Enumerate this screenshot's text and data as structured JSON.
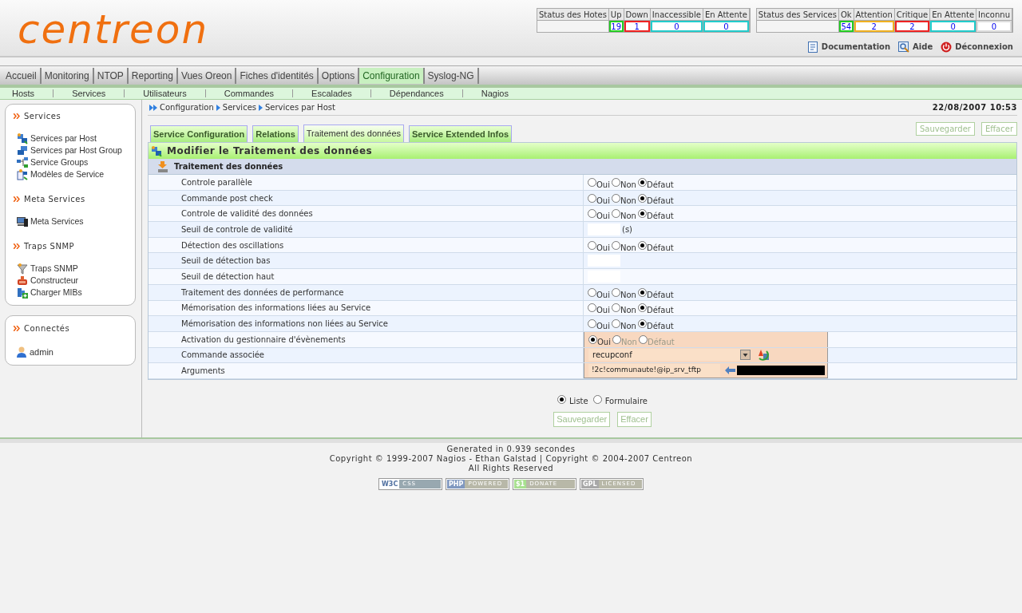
{
  "logo": {
    "text": "centreon"
  },
  "host_status": {
    "header": "Status des Hotes",
    "columns": [
      {
        "label": "Up",
        "value": "19",
        "color": "#22cc22"
      },
      {
        "label": "Down",
        "value": "1",
        "color": "#ee2222"
      },
      {
        "label": "Inaccessible",
        "value": "0",
        "color": "#22cccc"
      },
      {
        "label": "En Attente",
        "value": "0",
        "color": "#22cccc"
      }
    ]
  },
  "service_status": {
    "header": "Status des Services",
    "columns": [
      {
        "label": "Ok",
        "value": "54",
        "color": "#22cc22"
      },
      {
        "label": "Attention",
        "value": "2",
        "color": "#f0b020"
      },
      {
        "label": "Critique",
        "value": "2",
        "color": "#ee2222"
      },
      {
        "label": "En Attente",
        "value": "0",
        "color": "#22cccc"
      },
      {
        "label": "Inconnu",
        "value": "0",
        "color": "#dddddd"
      }
    ]
  },
  "top_links": [
    {
      "label": "Documentation",
      "kind": "doc"
    },
    {
      "label": "Aide",
      "kind": "help"
    },
    {
      "label": "Déconnexion",
      "kind": "logout"
    }
  ],
  "menu": [
    {
      "label": "Accueil",
      "selected": false
    },
    {
      "label": "Monitoring",
      "selected": false
    },
    {
      "label": "NTOP",
      "selected": false
    },
    {
      "label": "Reporting",
      "selected": false
    },
    {
      "label": "Vues Oreon",
      "selected": false
    },
    {
      "label": "Fiches d'identités",
      "selected": false
    },
    {
      "label": "Options",
      "selected": false
    },
    {
      "label": "Configuration",
      "selected": true
    },
    {
      "label": "Syslog-NG",
      "selected": false
    }
  ],
  "submenu": [
    "Hosts",
    "Services",
    "Utilisateurs",
    "Commandes",
    "Escalades",
    "Dépendances",
    "Nagios"
  ],
  "sidebar": {
    "sections": [
      {
        "title": "Services",
        "items": [
          {
            "label": "Services par Host",
            "kind": "host"
          },
          {
            "label": "Services par Host Group",
            "kind": "hostgroup"
          },
          {
            "label": "Service Groups",
            "kind": "group"
          },
          {
            "label": "Modèles de Service",
            "kind": "template"
          }
        ]
      },
      {
        "title": "Meta Services",
        "items": [
          {
            "label": "Meta Services",
            "kind": "computer"
          }
        ]
      },
      {
        "title": "Traps SNMP",
        "items": [
          {
            "label": "Traps SNMP",
            "kind": "funnel"
          },
          {
            "label": "Constructeur",
            "kind": "box"
          },
          {
            "label": "Charger MIBs",
            "kind": "add"
          }
        ]
      }
    ]
  },
  "connected": {
    "title": "Connectés",
    "users": [
      "admin"
    ]
  },
  "breadcrumb": [
    "Configuration",
    "Services",
    "Services par Host"
  ],
  "datetime": "22/08/2007 10:53",
  "tabs": [
    {
      "label": "Service Configuration",
      "selected": false
    },
    {
      "label": "Relations",
      "selected": false
    },
    {
      "label": "Traitement des données",
      "selected": true
    },
    {
      "label": "Service Extended Infos",
      "selected": false
    }
  ],
  "top_buttons": [
    "Sauvegarder",
    "Effacer"
  ],
  "form_title": "Modifier le Traitement des données",
  "section_title": "Traitement des données",
  "rows": [
    {
      "label": "Controle parallèle",
      "kind": "radio",
      "highlighted": false,
      "options": [
        {
          "label": "Oui",
          "selected": false
        },
        {
          "label": "Non",
          "selected": false
        },
        {
          "label": "Défaut",
          "selected": true
        }
      ]
    },
    {
      "label": "Commande post check",
      "kind": "radio",
      "highlighted": false,
      "options": [
        {
          "label": "Oui",
          "selected": false
        },
        {
          "label": "Non",
          "selected": false
        },
        {
          "label": "Défaut",
          "selected": true
        }
      ]
    },
    {
      "label": "Controle de validité des données",
      "kind": "radio",
      "highlighted": false,
      "options": [
        {
          "label": "Oui",
          "selected": false
        },
        {
          "label": "Non",
          "selected": false
        },
        {
          "label": "Défaut",
          "selected": true
        }
      ]
    },
    {
      "label": "Seuil de controle de validité",
      "kind": "input",
      "highlighted": false,
      "unit": "(s)"
    },
    {
      "label": "Détection des oscillations",
      "kind": "radio",
      "highlighted": false,
      "options": [
        {
          "label": "Oui",
          "selected": false
        },
        {
          "label": "Non",
          "selected": false
        },
        {
          "label": "Défaut",
          "selected": true
        }
      ]
    },
    {
      "label": "Seuil de détection bas",
      "kind": "input",
      "highlighted": false
    },
    {
      "label": "Seuil de détection haut",
      "kind": "input",
      "highlighted": false
    },
    {
      "label": "Traitement des données de performance",
      "kind": "radio",
      "highlighted": false,
      "options": [
        {
          "label": "Oui",
          "selected": false
        },
        {
          "label": "Non",
          "selected": false
        },
        {
          "label": "Défaut",
          "selected": true
        }
      ]
    },
    {
      "label": "Mémorisation des informations liées au Service",
      "kind": "radio",
      "highlighted": false,
      "options": [
        {
          "label": "Oui",
          "selected": false
        },
        {
          "label": "Non",
          "selected": false
        },
        {
          "label": "Défaut",
          "selected": true
        }
      ]
    },
    {
      "label": "Mémorisation des informations non liées au Service",
      "kind": "radio",
      "highlighted": false,
      "options": [
        {
          "label": "Oui",
          "selected": false
        },
        {
          "label": "Non",
          "selected": false
        },
        {
          "label": "Défaut",
          "selected": true
        }
      ]
    },
    {
      "label": "Activation du gestionnaire d'évènements",
      "kind": "radio",
      "highlighted": true,
      "options": [
        {
          "label": "Oui",
          "selected": true
        },
        {
          "label": "Non",
          "selected": false
        },
        {
          "label": "Défaut",
          "selected": false
        }
      ]
    },
    {
      "label": "Commande associée",
      "kind": "select",
      "highlighted": true,
      "value": "recupconf"
    },
    {
      "label": "Arguments",
      "kind": "args",
      "highlighted": true,
      "value": "!2c!communaute!@ip_srv_tftp"
    }
  ],
  "view_mode": [
    {
      "label": "Liste",
      "selected": true
    },
    {
      "label": "Formulaire",
      "selected": false
    }
  ],
  "bottom_buttons": [
    "Sauvegarder",
    "Effacer"
  ],
  "footer": {
    "lines": [
      "Generated in 0.939 secondes",
      "Copyright © 1999-2007 Nagios - Ethan Galstad | Copyright © 2004-2007 Centreon",
      "All Rights Reserved"
    ],
    "badges": [
      {
        "left": "W3C",
        "right": "CSS",
        "kind": "w3c"
      },
      {
        "left": "PHP",
        "right": "POWERED",
        "kind": "php"
      },
      {
        "left": "$1",
        "right": "DONATE",
        "kind": "donate"
      },
      {
        "left": "GPL",
        "right": "LICENSED",
        "kind": "gpl"
      }
    ]
  }
}
